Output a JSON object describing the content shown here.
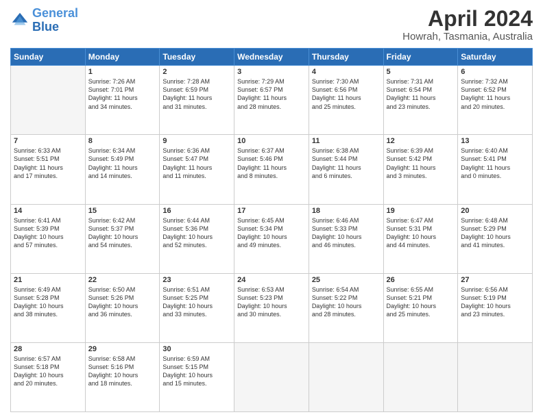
{
  "header": {
    "logo_line1": "General",
    "logo_line2": "Blue",
    "month": "April 2024",
    "location": "Howrah, Tasmania, Australia"
  },
  "weekdays": [
    "Sunday",
    "Monday",
    "Tuesday",
    "Wednesday",
    "Thursday",
    "Friday",
    "Saturday"
  ],
  "weeks": [
    [
      {
        "day": "",
        "info": ""
      },
      {
        "day": "1",
        "info": "Sunrise: 7:26 AM\nSunset: 7:01 PM\nDaylight: 11 hours\nand 34 minutes."
      },
      {
        "day": "2",
        "info": "Sunrise: 7:28 AM\nSunset: 6:59 PM\nDaylight: 11 hours\nand 31 minutes."
      },
      {
        "day": "3",
        "info": "Sunrise: 7:29 AM\nSunset: 6:57 PM\nDaylight: 11 hours\nand 28 minutes."
      },
      {
        "day": "4",
        "info": "Sunrise: 7:30 AM\nSunset: 6:56 PM\nDaylight: 11 hours\nand 25 minutes."
      },
      {
        "day": "5",
        "info": "Sunrise: 7:31 AM\nSunset: 6:54 PM\nDaylight: 11 hours\nand 23 minutes."
      },
      {
        "day": "6",
        "info": "Sunrise: 7:32 AM\nSunset: 6:52 PM\nDaylight: 11 hours\nand 20 minutes."
      }
    ],
    [
      {
        "day": "7",
        "info": "Sunrise: 6:33 AM\nSunset: 5:51 PM\nDaylight: 11 hours\nand 17 minutes."
      },
      {
        "day": "8",
        "info": "Sunrise: 6:34 AM\nSunset: 5:49 PM\nDaylight: 11 hours\nand 14 minutes."
      },
      {
        "day": "9",
        "info": "Sunrise: 6:36 AM\nSunset: 5:47 PM\nDaylight: 11 hours\nand 11 minutes."
      },
      {
        "day": "10",
        "info": "Sunrise: 6:37 AM\nSunset: 5:46 PM\nDaylight: 11 hours\nand 8 minutes."
      },
      {
        "day": "11",
        "info": "Sunrise: 6:38 AM\nSunset: 5:44 PM\nDaylight: 11 hours\nand 6 minutes."
      },
      {
        "day": "12",
        "info": "Sunrise: 6:39 AM\nSunset: 5:42 PM\nDaylight: 11 hours\nand 3 minutes."
      },
      {
        "day": "13",
        "info": "Sunrise: 6:40 AM\nSunset: 5:41 PM\nDaylight: 11 hours\nand 0 minutes."
      }
    ],
    [
      {
        "day": "14",
        "info": "Sunrise: 6:41 AM\nSunset: 5:39 PM\nDaylight: 10 hours\nand 57 minutes."
      },
      {
        "day": "15",
        "info": "Sunrise: 6:42 AM\nSunset: 5:37 PM\nDaylight: 10 hours\nand 54 minutes."
      },
      {
        "day": "16",
        "info": "Sunrise: 6:44 AM\nSunset: 5:36 PM\nDaylight: 10 hours\nand 52 minutes."
      },
      {
        "day": "17",
        "info": "Sunrise: 6:45 AM\nSunset: 5:34 PM\nDaylight: 10 hours\nand 49 minutes."
      },
      {
        "day": "18",
        "info": "Sunrise: 6:46 AM\nSunset: 5:33 PM\nDaylight: 10 hours\nand 46 minutes."
      },
      {
        "day": "19",
        "info": "Sunrise: 6:47 AM\nSunset: 5:31 PM\nDaylight: 10 hours\nand 44 minutes."
      },
      {
        "day": "20",
        "info": "Sunrise: 6:48 AM\nSunset: 5:29 PM\nDaylight: 10 hours\nand 41 minutes."
      }
    ],
    [
      {
        "day": "21",
        "info": "Sunrise: 6:49 AM\nSunset: 5:28 PM\nDaylight: 10 hours\nand 38 minutes."
      },
      {
        "day": "22",
        "info": "Sunrise: 6:50 AM\nSunset: 5:26 PM\nDaylight: 10 hours\nand 36 minutes."
      },
      {
        "day": "23",
        "info": "Sunrise: 6:51 AM\nSunset: 5:25 PM\nDaylight: 10 hours\nand 33 minutes."
      },
      {
        "day": "24",
        "info": "Sunrise: 6:53 AM\nSunset: 5:23 PM\nDaylight: 10 hours\nand 30 minutes."
      },
      {
        "day": "25",
        "info": "Sunrise: 6:54 AM\nSunset: 5:22 PM\nDaylight: 10 hours\nand 28 minutes."
      },
      {
        "day": "26",
        "info": "Sunrise: 6:55 AM\nSunset: 5:21 PM\nDaylight: 10 hours\nand 25 minutes."
      },
      {
        "day": "27",
        "info": "Sunrise: 6:56 AM\nSunset: 5:19 PM\nDaylight: 10 hours\nand 23 minutes."
      }
    ],
    [
      {
        "day": "28",
        "info": "Sunrise: 6:57 AM\nSunset: 5:18 PM\nDaylight: 10 hours\nand 20 minutes."
      },
      {
        "day": "29",
        "info": "Sunrise: 6:58 AM\nSunset: 5:16 PM\nDaylight: 10 hours\nand 18 minutes."
      },
      {
        "day": "30",
        "info": "Sunrise: 6:59 AM\nSunset: 5:15 PM\nDaylight: 10 hours\nand 15 minutes."
      },
      {
        "day": "",
        "info": ""
      },
      {
        "day": "",
        "info": ""
      },
      {
        "day": "",
        "info": ""
      },
      {
        "day": "",
        "info": ""
      }
    ]
  ]
}
